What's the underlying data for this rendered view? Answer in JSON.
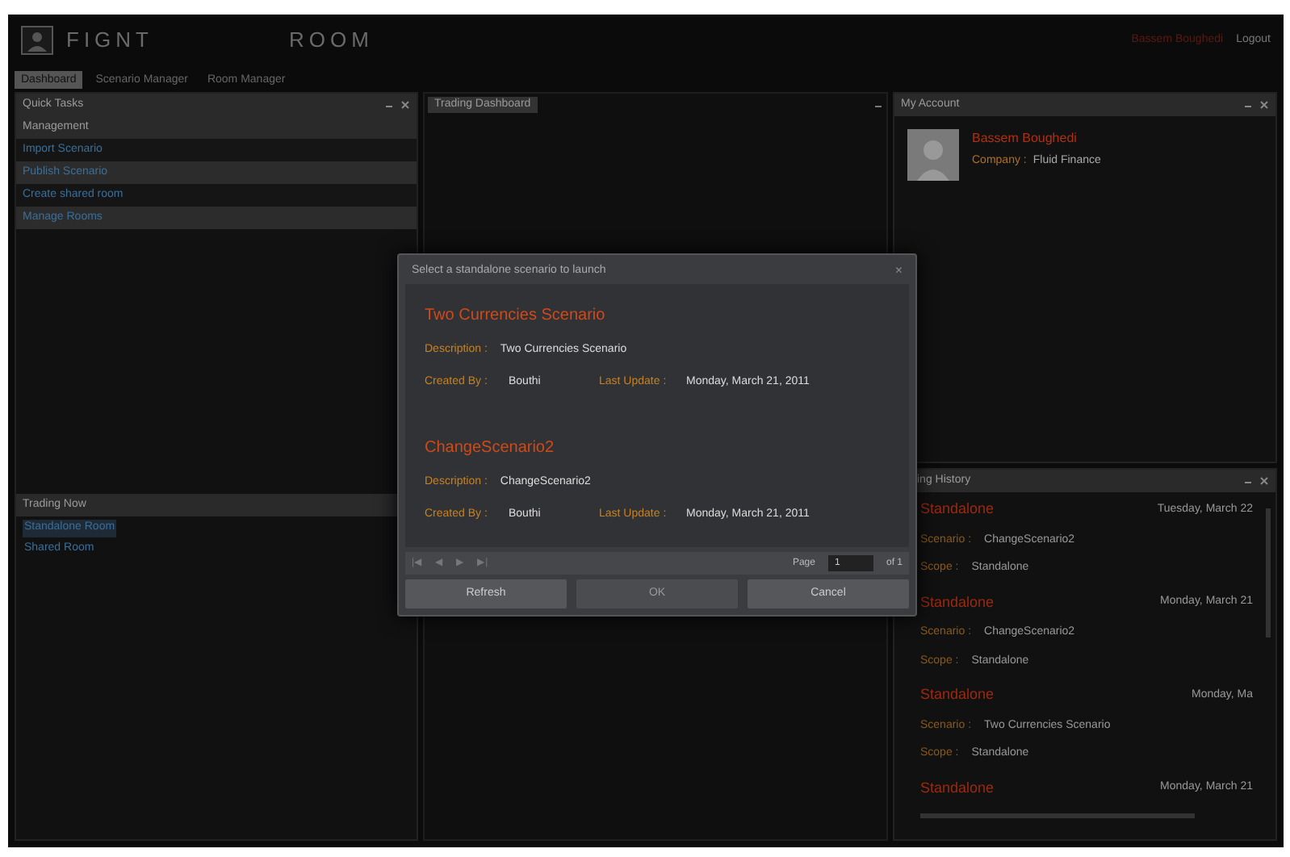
{
  "header": {
    "brand_left": "FIGNT",
    "brand_right": "ROOM",
    "user": "Bassem Boughedi",
    "logout": "Logout"
  },
  "tabs": [
    {
      "label": "Dashboard",
      "selected": true
    },
    {
      "label": "Scenario Manager",
      "selected": false
    },
    {
      "label": "Room Manager",
      "selected": false
    }
  ],
  "quick_tasks": {
    "title": "Quick Tasks",
    "section": "Management",
    "items": [
      {
        "label": "Import Scenario",
        "selected": false
      },
      {
        "label": "Publish Scenario",
        "selected": true
      },
      {
        "label": "Create shared room",
        "selected": false
      },
      {
        "label": "Manage Rooms",
        "selected": true
      }
    ]
  },
  "trading_now": {
    "title": "Trading Now",
    "items": [
      {
        "label": "Standalone Room",
        "selected": true
      },
      {
        "label": "Shared Room",
        "selected": false
      }
    ]
  },
  "dashboard": {
    "title": "Trading Dashboard"
  },
  "account": {
    "title": "My Account",
    "name": "Bassem Boughedi",
    "company_label": "Company :",
    "company": "Fluid Finance"
  },
  "history": {
    "title": "ing History",
    "entries": [
      {
        "type": "Standalone",
        "date": "Tuesday, March 22",
        "scenario_label": "Scenario :",
        "scenario": "ChangeScenario2",
        "scope_label": "Scope :",
        "scope": "Standalone"
      },
      {
        "type": "Standalone",
        "date": "Monday, March 21",
        "scenario_label": "Scenario :",
        "scenario": "ChangeScenario2",
        "scope_label": "Scope :",
        "scope": "Standalone"
      },
      {
        "type": "Standalone",
        "date": "Monday, Ma",
        "scenario_label": "Scenario :",
        "scenario": "Two Currencies Scenario",
        "scope_label": "Scope :",
        "scope": "Standalone"
      },
      {
        "type": "Standalone",
        "date": "Monday, March 21"
      }
    ]
  },
  "dialog": {
    "title": "Select a standalone scenario to launch",
    "close": "×",
    "scenarios": [
      {
        "name": "Two Currencies Scenario",
        "description_label": "Description :",
        "description": "Two Currencies Scenario",
        "created_label": "Created By :",
        "created_by": "Bouthi",
        "updated_label": "Last Update :",
        "updated": "Monday, March 21, 2011"
      },
      {
        "name": "ChangeScenario2",
        "description_label": "Description :",
        "description": "ChangeScenario2",
        "created_label": "Created By :",
        "created_by": "Bouthi",
        "updated_label": "Last Update :",
        "updated": "Monday, March 21, 2011"
      }
    ],
    "pager": {
      "first": "|◀",
      "prev": "◀",
      "next": "▶",
      "last": "▶|",
      "page_label": "Page",
      "page": "1",
      "of": "of 1"
    },
    "buttons": [
      {
        "label": "Refresh",
        "disabled": false
      },
      {
        "label": "OK",
        "disabled": true
      },
      {
        "label": "Cancel",
        "disabled": false
      }
    ]
  }
}
